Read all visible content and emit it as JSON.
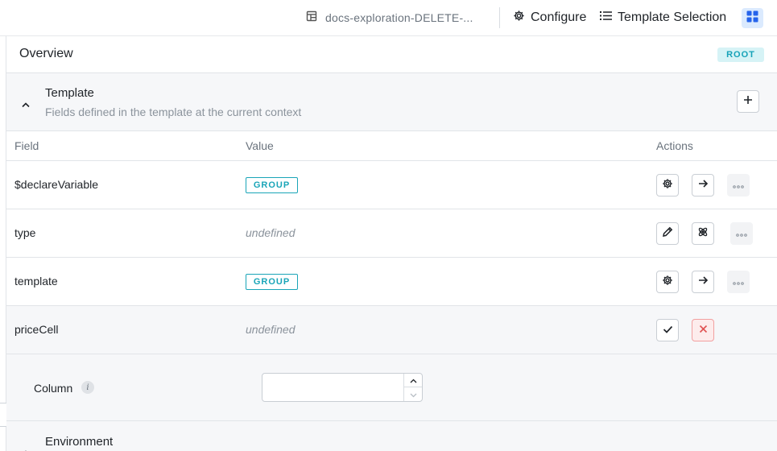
{
  "topbar": {
    "doc_title": "docs-exploration-DELETE-...",
    "configure_label": "Configure",
    "template_selection_label": "Template Selection",
    "accent_color": "#dbeafe"
  },
  "overview": {
    "title": "Overview",
    "badge": "ROOT"
  },
  "template_section": {
    "title": "Template",
    "subtitle": "Fields defined in the template at the current context"
  },
  "table": {
    "headers": {
      "field": "Field",
      "value": "Value",
      "actions": "Actions"
    },
    "rows": [
      {
        "field": "$declareVariable",
        "value": "GROUP",
        "value_kind": "group"
      },
      {
        "field": "type",
        "value": "undefined",
        "value_kind": "undefined"
      },
      {
        "field": "template",
        "value": "GROUP",
        "value_kind": "group"
      },
      {
        "field": "priceCell",
        "value": "undefined",
        "value_kind": "undefined"
      }
    ]
  },
  "editor": {
    "label": "Column",
    "info_glyph": "i",
    "input_value": ""
  },
  "environment_section": {
    "title": "Environment"
  },
  "icons": [
    "table-icon",
    "gear-icon",
    "list-icon",
    "grid-icon",
    "chevron-up-icon",
    "plus-icon",
    "arrow-right-icon",
    "more-icon",
    "pencil-icon",
    "atom-icon",
    "check-icon",
    "close-icon",
    "info-icon"
  ],
  "colors": {
    "teal": "#1aa5b8",
    "danger": "#e05252"
  }
}
